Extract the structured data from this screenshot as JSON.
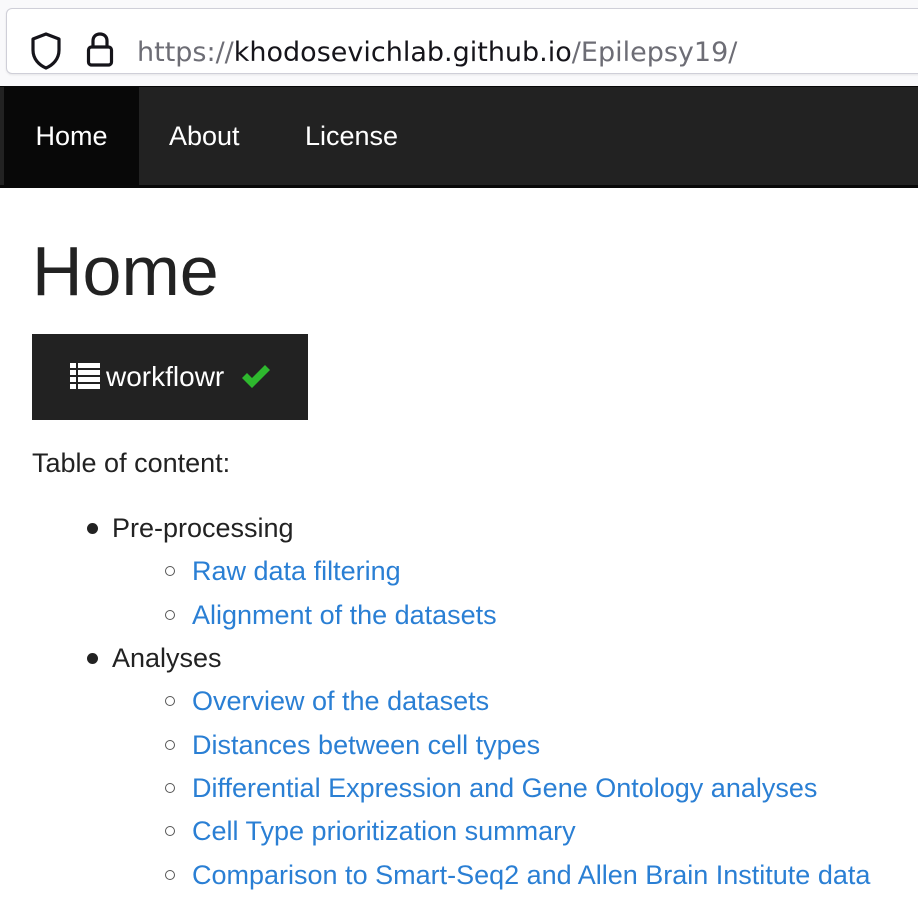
{
  "browser": {
    "url_scheme": "https://",
    "url_host": "khodosevichlab.github.io",
    "url_path": "/Epilepsy19/",
    "icons": [
      "shield-icon",
      "lock-icon"
    ]
  },
  "navbar": {
    "items": [
      {
        "label": "Home",
        "active": true
      },
      {
        "label": "About",
        "active": false
      },
      {
        "label": "License",
        "active": false
      }
    ]
  },
  "page": {
    "title": "Home",
    "workflowr_button": {
      "label": "workflowr",
      "icons": [
        "list-icon",
        "checkmark-icon"
      ],
      "check_color": "#2eb82e"
    },
    "toc_heading": "Table of content:",
    "sections": [
      {
        "label": "Pre-processing",
        "links": [
          "Raw data filtering",
          "Alignment of the datasets"
        ]
      },
      {
        "label": "Analyses",
        "links": [
          "Overview of the datasets",
          "Distances between cell types",
          "Differential Expression and Gene Ontology analyses",
          "Cell Type prioritization summary",
          "Comparison to Smart-Seq2 and Allen Brain Institute data"
        ]
      }
    ]
  },
  "colors": {
    "navbar_bg": "#222222",
    "navbar_active_bg": "#080808",
    "link": "#2a7fd4",
    "text": "#222222"
  }
}
